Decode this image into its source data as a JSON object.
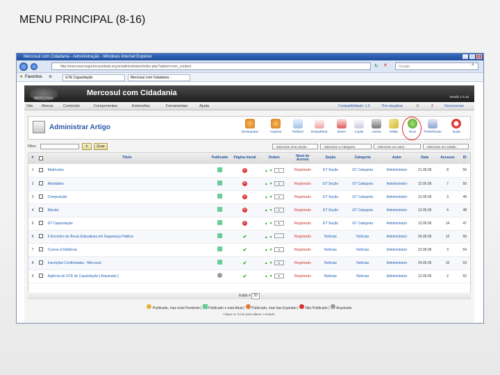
{
  "slide": {
    "title": "MENU PRINCIPAL (8-16)"
  },
  "window": {
    "title": "Mercosul com Cidadania - Administração - Windows Internet Explorer"
  },
  "addressbar": {
    "url": "http://mercosul.segurancacidada.org.br/administrator/index.php?option=com_content",
    "search_placeholder": "Google"
  },
  "favorites": {
    "label": "Favoritos",
    "tabs": [
      "GTE Capacitação",
      "Mercosul com Cidadania -"
    ]
  },
  "app": {
    "title": "Mercosul com Cidadania",
    "version": "Versão 1.5.10",
    "logo": "MERCOSUL"
  },
  "menu": {
    "items": [
      "Site",
      "Menus",
      "Conteúdo",
      "Componentes",
      "Extensões",
      "Ferramentas",
      "Ajuda"
    ],
    "compat": "Compatibilidade: 1.0",
    "preview": "Pré-visualizar",
    "count1": "0",
    "count2": "2",
    "logout": "Desconectar"
  },
  "toolbar": {
    "heading": "Administrar Artigo",
    "buttons": [
      "Desarquivar",
      "Arquivar",
      "Publicar",
      "Despublicar",
      "Mover",
      "Copiar",
      "Lixeira",
      "Editar",
      "Novo",
      "Preferências",
      "Ajuda"
    ]
  },
  "filter": {
    "label": "Filtro:",
    "go": "Ir",
    "reset": "Zerar",
    "selects": [
      "- Selecione uma Seção -",
      "- Selecione a Categoria -",
      "- Selecione um autor -",
      "- Selecione um estado -"
    ]
  },
  "table": {
    "headers": [
      "#",
      "",
      "Título",
      "Publicado",
      "Página Inicial",
      "Ordem",
      "Nível de Acesso",
      "Seção",
      "Categoria",
      "Autor",
      "Data",
      "Acessos",
      "ID"
    ],
    "rows": [
      {
        "n": "1",
        "title": "Matrículas",
        "pub": "ok",
        "front": "x",
        "order": "1",
        "access": "Registrado",
        "section": "GT Seção",
        "category": "GT Categoria",
        "author": "Administrator",
        "date": "21.05.09",
        "hits": "8",
        "id": "50"
      },
      {
        "n": "2",
        "title": "Atividades",
        "pub": "ok",
        "front": "x",
        "order": "2",
        "access": "Registrado",
        "section": "GT Seção",
        "category": "GT Categoria",
        "author": "Administrator",
        "date": "12.05.09",
        "hits": "7",
        "id": "50"
      },
      {
        "n": "3",
        "title": "Composição",
        "pub": "ok",
        "front": "x",
        "order": "3",
        "access": "Registrado",
        "section": "GT Seção",
        "category": "GT Categoria",
        "author": "Administrator",
        "date": "12.05.09",
        "hits": "3",
        "id": "49"
      },
      {
        "n": "4",
        "title": "Missão",
        "pub": "ok",
        "front": "x",
        "order": "4",
        "access": "Registrado",
        "section": "GT Seção",
        "category": "GT Categoria",
        "author": "Administrator",
        "date": "12.05.09",
        "hits": "4",
        "id": "48"
      },
      {
        "n": "5",
        "title": "GT Capacitação",
        "pub": "ok",
        "front": "x",
        "order": "5",
        "access": "Registrado",
        "section": "GT Seção",
        "category": "GT Categoria",
        "author": "Administrator",
        "date": "12.05.09",
        "hits": "14",
        "id": "47"
      },
      {
        "n": "6",
        "title": "II Encontro de Áreas Educativas em Segurança Pública",
        "pub": "ok",
        "front": "check",
        "order": "",
        "access": "Registrado",
        "section": "Notícias",
        "category": "Notícias",
        "author": "Administrator",
        "date": "26.05.09",
        "hits": "12",
        "id": "55"
      },
      {
        "n": "7",
        "title": "Cursos à Distância",
        "pub": "ok",
        "front": "check",
        "order": "3",
        "access": "Registrado",
        "section": "Notícias",
        "category": "Notícias",
        "author": "Administrator",
        "date": "12.05.09",
        "hits": "3",
        "id": "54"
      },
      {
        "n": "8",
        "title": "Inscrições Confirmadas - Mercosul",
        "pub": "ok",
        "front": "check",
        "order": "4",
        "access": "Registrado",
        "section": "Notícias",
        "category": "Notícias",
        "author": "Administrator",
        "date": "24.05.09",
        "hits": "10",
        "id": "53"
      },
      {
        "n": "9",
        "title": "Agência do GTE de Capacitação [ Arquivado ]",
        "pub": "no",
        "front": "check",
        "order": "5",
        "access": "Registrado",
        "section": "Notícias",
        "category": "Notícias",
        "author": "Administrator",
        "date": "12.05.09",
        "hits": "2",
        "id": "52"
      }
    ]
  },
  "pager": {
    "label": "Exibir #",
    "value": "20"
  },
  "legend": {
    "items": [
      "Publicado, mas está Pendente",
      "Publicado e está Atual",
      "Publicado, mas has Expirado",
      "Não Publicado",
      "Arquivado"
    ],
    "note": "Clique no ícone para alterar o estado."
  }
}
